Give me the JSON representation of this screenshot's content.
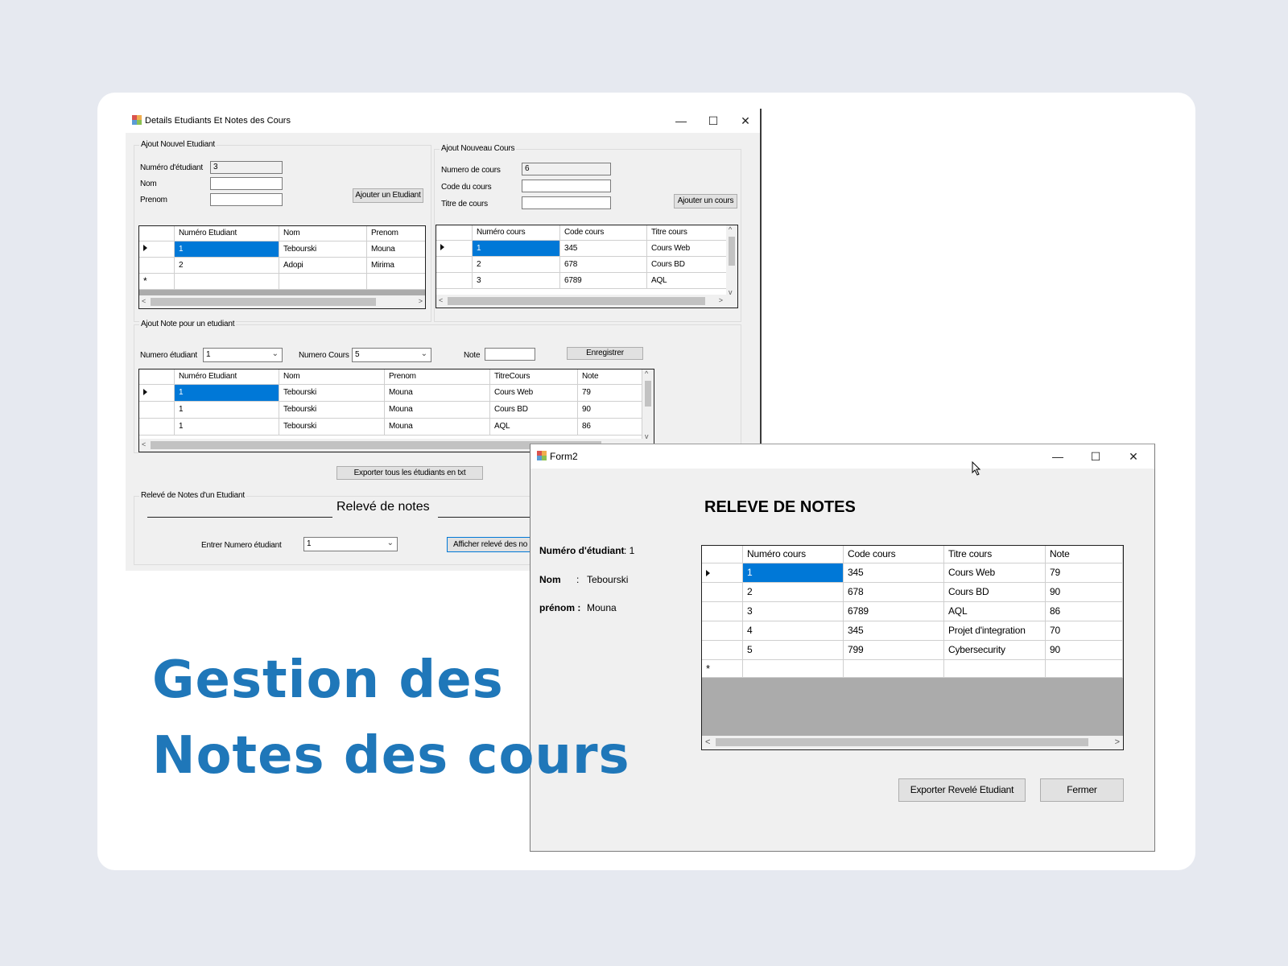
{
  "colors": {
    "background": "#e6e9f0",
    "card": "#ffffff",
    "heading": "#1f77b9",
    "selection": "#0078d7"
  },
  "heading": {
    "line1": "Gestion des",
    "line2": "Notes des cours"
  },
  "main_window": {
    "title": "Details Etudiants Et Notes des Cours",
    "window_buttons": {
      "minimize": "—",
      "maximize": "☐",
      "close": "✕"
    },
    "student_group": {
      "title": "Ajout Nouvel Etudiant",
      "num_label": "Numéro d'étudiant",
      "num_value": "3",
      "nom_label": "Nom",
      "nom_value": "",
      "prenom_label": "Prenom",
      "prenom_value": "",
      "add_button": "Ajouter un Etudiant"
    },
    "course_group": {
      "title": "Ajout Nouveau Cours",
      "num_label": "Numero de cours",
      "num_value": "6",
      "code_label": "Code du cours",
      "code_value": "",
      "titre_label": "Titre de cours",
      "titre_value": "",
      "add_button": "Ajouter un cours"
    },
    "students_grid": {
      "headers": [
        "Numéro Etudiant",
        "Nom",
        "Prenom"
      ],
      "rows": [
        [
          "1",
          "Tebourski",
          "Mouna"
        ],
        [
          "2",
          "Adopi",
          "Mirima"
        ]
      ]
    },
    "courses_grid": {
      "headers": [
        "Numéro cours",
        "Code cours",
        "Titre cours"
      ],
      "rows": [
        [
          "1",
          "345",
          "Cours Web"
        ],
        [
          "2",
          "678",
          "Cours BD"
        ],
        [
          "3",
          "6789",
          "AQL"
        ]
      ]
    },
    "note_group": {
      "title": "Ajout Note pour un etudiant",
      "student_label": "Numero étudiant",
      "student_value": "1",
      "course_label": "Numero Cours",
      "course_value": "5",
      "note_label": "Note",
      "note_value": "",
      "save_button": "Enregistrer"
    },
    "notes_grid": {
      "headers": [
        "Numéro Etudiant",
        "Nom",
        "Prenom",
        "TitreCours",
        "Note"
      ],
      "rows": [
        [
          "1",
          "Tebourski",
          "Mouna",
          "Cours Web",
          "79"
        ],
        [
          "1",
          "Tebourski",
          "Mouna",
          "Cours BD",
          "90"
        ],
        [
          "1",
          "Tebourski",
          "Mouna",
          "AQL",
          "86"
        ]
      ]
    },
    "export_all_button": "Exporter tous les étudiants en txt",
    "releve_group": {
      "title": "Relevé de Notes d'un Etudiant",
      "center_title": "Relevé de notes",
      "enter_label": "Entrer Numero étudiant",
      "enter_value": "1",
      "show_button": "Afficher relevé des no"
    }
  },
  "form2": {
    "title": "Form2",
    "window_buttons": {
      "minimize": "—",
      "maximize": "☐",
      "close": "✕"
    },
    "heading": "RELEVE DE NOTES",
    "num_label": "Numéro d'étudiant",
    "num_value": ": 1",
    "nom_label": "Nom",
    "nom_sep": ":",
    "nom_value": "Tebourski",
    "prenom_label": "prénom :",
    "prenom_value": "Mouna",
    "grid": {
      "headers": [
        "Numéro cours",
        "Code cours",
        "Titre cours",
        "Note"
      ],
      "rows": [
        [
          "1",
          "345",
          "Cours Web",
          "79"
        ],
        [
          "2",
          "678",
          "Cours BD",
          "90"
        ],
        [
          "3",
          "6789",
          "AQL",
          "86"
        ],
        [
          "4",
          "345",
          "Projet d'integration",
          "70"
        ],
        [
          "5",
          "799",
          "Cybersecurity",
          "90"
        ]
      ]
    },
    "export_button": "Exporter Revelé Etudiant",
    "close_button": "Fermer"
  }
}
